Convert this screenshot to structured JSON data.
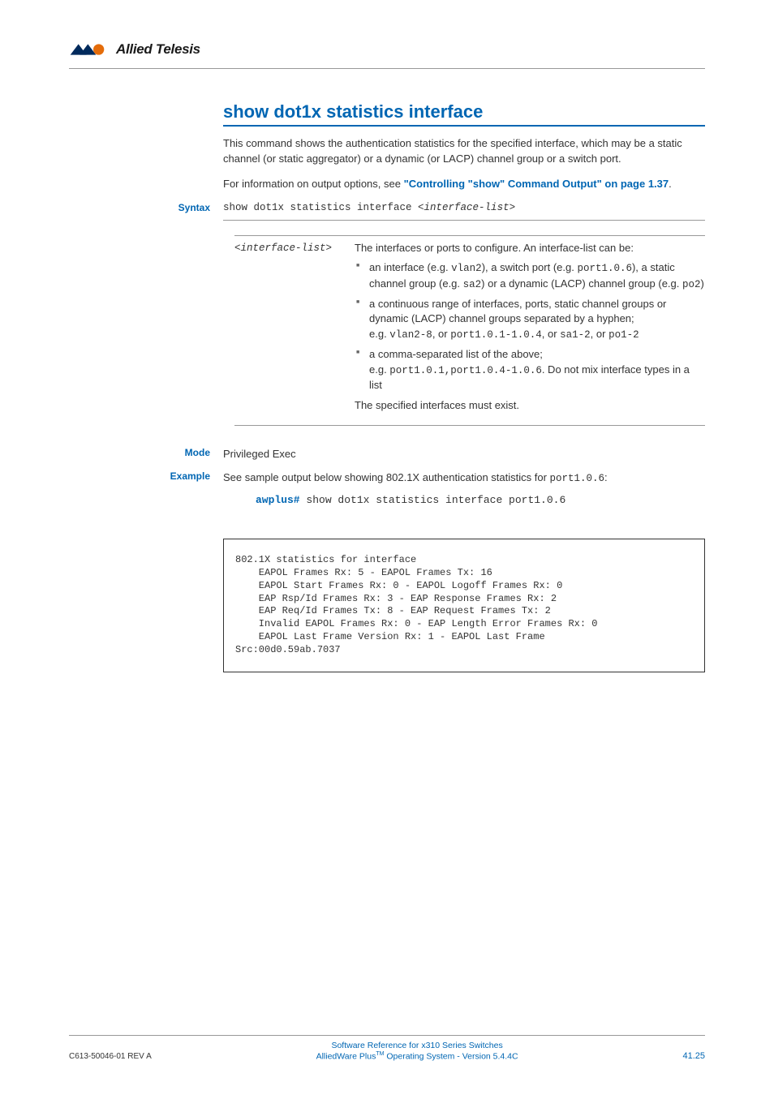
{
  "header": {
    "brand_name": "Allied Telesis"
  },
  "section": {
    "title": "show dot1x statistics interface",
    "intro": "This command shows the authentication statistics for the specified interface, which may be a static channel (or static aggregator) or a dynamic (or LACP) channel group or a switch port.",
    "info_lead": "For information on output options, see ",
    "info_link": "\"Controlling \"show\" Command Output\" on page 1.37",
    "info_tail": "."
  },
  "syntax": {
    "label": "Syntax",
    "command_pre": "show dot1x statistics interface ",
    "command_arg": "<interface-list>"
  },
  "params": {
    "name": "<interface-list>",
    "desc_intro": "The interfaces or ports to configure. An interface-list can be:",
    "bullets": [
      {
        "pre": "an interface (e.g. ",
        "c1": "vlan2",
        "m1": "), a switch port (e.g. ",
        "c2": "port1.0.6",
        "m2": "), a static channel group (e.g. ",
        "c3": "sa2",
        "m3": ") or a dynamic (LACP) channel group (e.g. ",
        "c4": "po2",
        "tail": ")"
      },
      {
        "pre": "a continuous range of interfaces, ports, static channel groups or dynamic (LACP) channel groups separated by a hyphen;",
        "eg_lead": "e.g. ",
        "c1": "vlan2-8",
        "m1": ", or ",
        "c2": "port1.0.1-1.0.4",
        "m2": ", or ",
        "c3": "sa1-2",
        "m3": ", or ",
        "c4": "po1-2"
      },
      {
        "pre": "a comma-separated list of the above;",
        "eg_lead": "e.g. ",
        "c1": "port1.0.1,port1.0.4-1.0.6",
        "tail": ". Do not mix interface types in a list"
      }
    ],
    "desc_outro": "The specified interfaces must exist."
  },
  "mode": {
    "label": "Mode",
    "value": "Privileged Exec"
  },
  "example": {
    "label": "Example",
    "intro_pre": "See sample output below showing 802.1X authentication statistics for ",
    "intro_code": "port1.0.6",
    "intro_tail": ":",
    "prompt": "awplus#",
    "command": " show dot1x statistics interface port1.0.6"
  },
  "chart_data": {
    "type": "table",
    "title": "802.1X statistics for interface",
    "rows": [
      {
        "name": "EAPOL Frames Rx",
        "value": 5,
        "name2": "EAPOL Frames Tx",
        "value2": 16
      },
      {
        "name": "EAPOL Start Frames Rx",
        "value": 0,
        "name2": "EAPOL Logoff Frames Rx",
        "value2": 0
      },
      {
        "name": "EAP Rsp/Id Frames Rx",
        "value": 3,
        "name2": "EAP Response Frames Rx",
        "value2": 2
      },
      {
        "name": "EAP Req/Id Frames Tx",
        "value": 8,
        "name2": "EAP Request Frames Tx",
        "value2": 2
      },
      {
        "name": "Invalid EAPOL Frames Rx",
        "value": 0,
        "name2": "EAP Length Error Frames Rx",
        "value2": 0
      },
      {
        "name": "EAPOL Last Frame Version Rx",
        "value": 1,
        "name2": "EAPOL Last Frame Src",
        "value2": "00d0.59ab.7037"
      }
    ]
  },
  "output": {
    "text": "802.1X statistics for interface \n    EAPOL Frames Rx: 5 - EAPOL Frames Tx: 16\n    EAPOL Start Frames Rx: 0 - EAPOL Logoff Frames Rx: 0\n    EAP Rsp/Id Frames Rx: 3 - EAP Response Frames Rx: 2\n    EAP Req/Id Frames Tx: 8 - EAP Request Frames Tx: 2\n    Invalid EAPOL Frames Rx: 0 - EAP Length Error Frames Rx: 0\n    EAPOL Last Frame Version Rx: 1 - EAPOL Last Frame \nSrc:00d0.59ab.7037"
  },
  "footer": {
    "left": "C613-50046-01 REV A",
    "center_line1": "Software Reference for x310 Series Switches",
    "center_line2_pre": "AlliedWare Plus",
    "center_line2_tm": "TM",
    "center_line2_post": " Operating System - Version 5.4.4C",
    "right": "41.25"
  }
}
